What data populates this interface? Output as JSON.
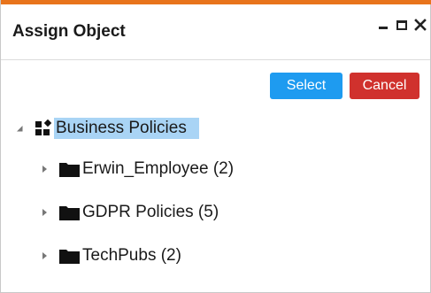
{
  "dialog": {
    "title": "Assign Object",
    "controls": {
      "minimize_icon": "minimize-icon",
      "maximize_icon": "maximize-icon",
      "close_icon": "close-icon"
    }
  },
  "actions": {
    "select_label": "Select",
    "cancel_label": "Cancel"
  },
  "tree": {
    "root": {
      "label": "Business Policies",
      "icon": "business-policies-icon",
      "expanded": true,
      "selected": true
    },
    "children": [
      {
        "label": "Erwin_Employee (2)",
        "icon": "folder-icon"
      },
      {
        "label": "GDPR Policies (5)",
        "icon": "folder-icon"
      },
      {
        "label": "TechPubs (2)",
        "icon": "folder-icon"
      }
    ]
  },
  "colors": {
    "accent_top": "#e8741c",
    "select_button": "#1e9bf0",
    "cancel_button": "#d0312d",
    "selection_highlight": "#a9d4f5"
  }
}
